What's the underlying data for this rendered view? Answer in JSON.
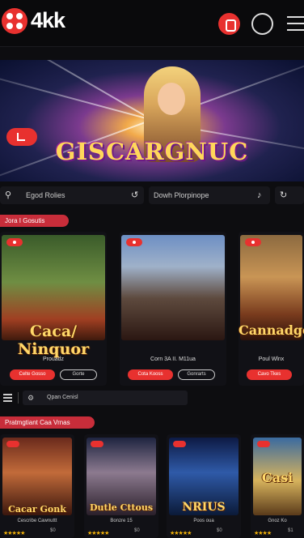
{
  "header": {
    "brand": "4kk",
    "icons": [
      "logo-icon",
      "wallet-icon",
      "user-icon",
      "menu-icon"
    ]
  },
  "hero": {
    "title": "GISCARGNUC"
  },
  "search_bar": {
    "left": "Egod Rolies",
    "middle": "Dowh Plorpinope"
  },
  "section1": {
    "title": "Jora I Gosutis",
    "cards": [
      {
        "art_title": "Caca/ Ninquor",
        "name": "Prouadz",
        "primary": "Celte Gosso",
        "secondary": "Gorte"
      },
      {
        "art_title": "",
        "name": "Corn 3A II. M11ua",
        "primary": "Cota Kooss",
        "secondary": "Gonrarts"
      },
      {
        "art_title": "Cannadge",
        "name": "Poul Wlnx",
        "primary": "Cavo Tkes",
        "secondary": ""
      }
    ]
  },
  "toolbar": {
    "search_text": "Qpan Cenisl"
  },
  "section2": {
    "title": "Pratmgtiant Caa Vrnas",
    "cards": [
      {
        "art_title": "Cacar Gonk",
        "name": "Cescribe Cawnuttt"
      },
      {
        "art_title": "Dutle Cttous",
        "name": "Bonzre 15"
      },
      {
        "art_title": "NRIUS",
        "name": "Poos oua"
      },
      {
        "art_title": "Casi",
        "name": "Gnoz Ko"
      }
    ],
    "ratings": [
      "$0",
      "$0",
      "$0",
      "$1"
    ]
  },
  "colors": {
    "accent": "#e8312f",
    "background": "#0d0d10"
  }
}
